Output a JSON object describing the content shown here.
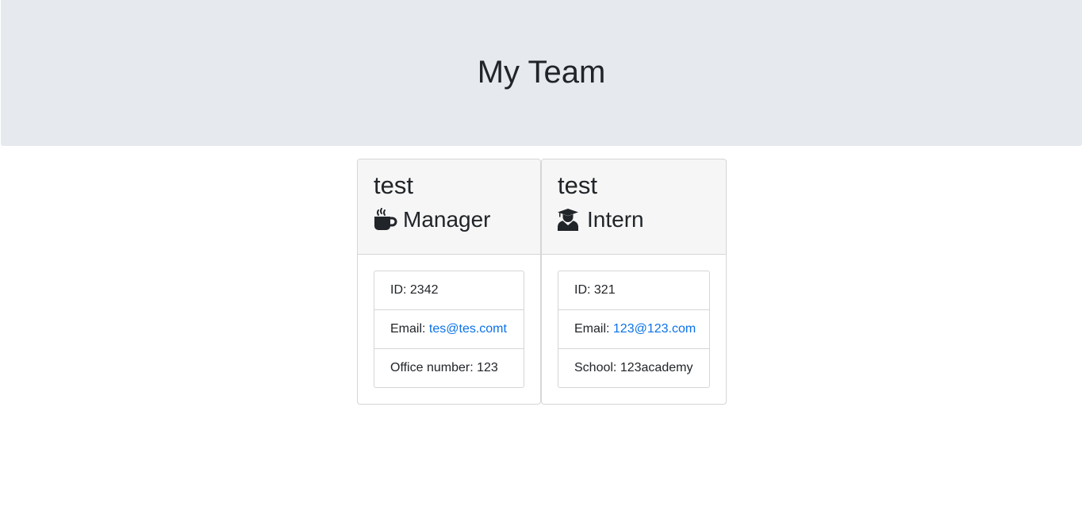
{
  "header": {
    "title": "My Team"
  },
  "employees": [
    {
      "name": "test",
      "role": "Manager",
      "icon": "coffee-mug-icon",
      "id_label": "ID:",
      "id": "2342",
      "email_label": "Email:",
      "email": "tes@tes.comt",
      "extra_label": "Office number:",
      "extra_value": "123"
    },
    {
      "name": "test",
      "role": "Intern",
      "icon": "graduate-icon",
      "id_label": "ID:",
      "id": "321",
      "email_label": "Email:",
      "email": "123@123.com",
      "extra_label": "School:",
      "extra_value": "123academy"
    }
  ],
  "colors": {
    "jumbotron_bg": "#e6e9ed",
    "card_header_bg": "#f6f6f6",
    "link": "#0a71e8",
    "text": "#212529"
  }
}
